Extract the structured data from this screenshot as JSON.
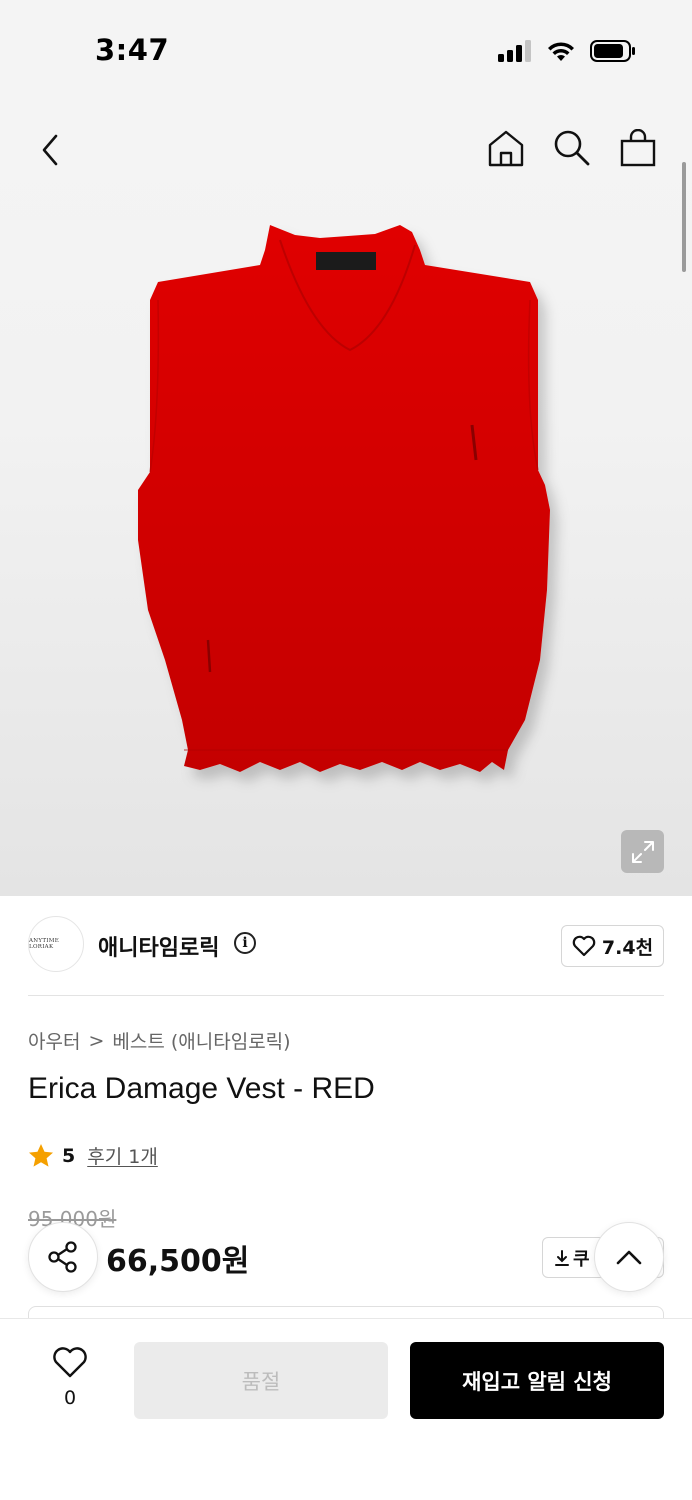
{
  "status_bar": {
    "time": "3:47"
  },
  "brand": {
    "logo_text": "ANYTIME LORIAK",
    "name": "애니타임로릭",
    "info_glyph": "i",
    "likes": "7.4천"
  },
  "breadcrumb": {
    "category": "아우터",
    "separator": ">",
    "subcategory": "베스트 (애니타임로릭)"
  },
  "product": {
    "title": "Erica Damage Vest - RED",
    "rating": "5",
    "reviews_label": "후기 1개",
    "original_price": "95,000원",
    "price": "66,500원",
    "color": "#d90000"
  },
  "actions": {
    "coupon_label": "쿠"
  },
  "bottom_bar": {
    "wish_count": "0",
    "soldout_label": "품절",
    "restock_label": "재입고 알림 신청"
  }
}
